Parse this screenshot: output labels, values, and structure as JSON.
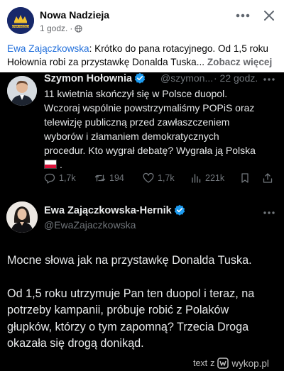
{
  "post": {
    "page_name": "Nowa Nadzieja",
    "avatar_text": "NOWA NADZIEJA",
    "time": "1 godz.",
    "separator": "·",
    "caption_author": "Ewa Zajączkowska",
    "caption_line1": ": Krótko do pana rotacyjnego. Od 1,5 roku",
    "caption_line2": "Hołownia robi za przystawkę Donalda Tuska...",
    "see_more": "Zobacz więcej",
    "icons": {
      "more": "more-icon",
      "close": "close-icon",
      "audience": "globe-icon"
    }
  },
  "tweet1": {
    "name": "Szymon Hołownia",
    "handle": "@szymon...",
    "time": "· 22 godz.",
    "lines": [
      "11 kwietnia skończył się w Polsce duopol.",
      "Wczoraj wspólnie powstrzymaliśmy POPiS oraz",
      "telewizję publiczną przed zawłaszczeniem",
      "wyborów i złamaniem demokratycznych",
      "procedur. Kto wygrał debatę? Wygrała ją Polska",
      "."
    ],
    "actions": {
      "replies": "1,7k",
      "reposts": "194",
      "likes": "1,7k",
      "views": "221k"
    }
  },
  "tweet2": {
    "name": "Ewa Zajączkowska-Hernik",
    "handle": "@EwaZajaczkowska",
    "paragraph1": "Mocne słowa jak na przystawkę Donalda Tuska.",
    "paragraph2_lines": [
      "Od 1,5 roku utrzymuje Pan ten duopol i teraz, na",
      "potrzeby kampanii, próbuje robić z Polaków",
      "głupków, którzy o tym zapomną? Trzecia Droga",
      "okazała się drogą donikąd."
    ]
  },
  "watermark": {
    "text": "text",
    "z": "z",
    "site": "wykop.pl"
  },
  "colors": {
    "x_background": "#000000",
    "x_text": "#e7e9ea",
    "x_muted": "#71767b",
    "verified": "#1d9bf0",
    "fb_link": "#216fdb"
  }
}
